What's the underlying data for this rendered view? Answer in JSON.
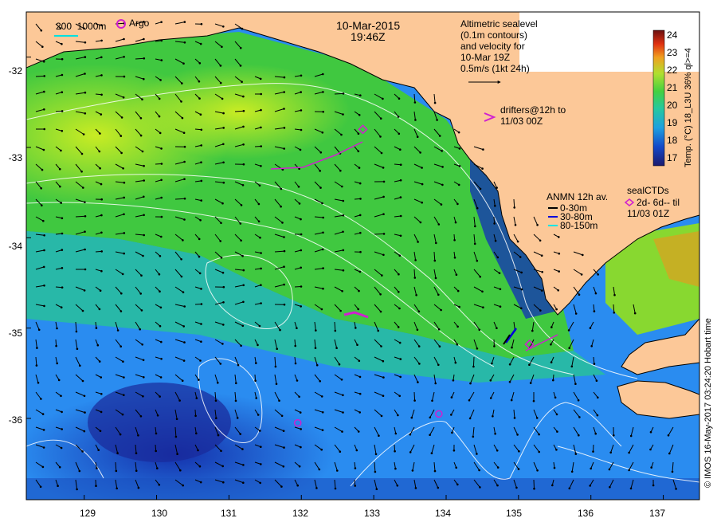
{
  "header": {
    "date": "10-Mar-2015",
    "time": "19:46Z"
  },
  "legend": {
    "isobath": "200  1000m",
    "argo": "Argo",
    "altimetry_lines": [
      "Altimetric sealevel",
      "(0.1m contours)",
      "and velocity for",
      "10-Mar 19Z",
      "0.5m/s (1kt 24h)"
    ],
    "drifters_lines": [
      "drifters@12h to",
      "11/03 00Z"
    ],
    "anmn_title": "ANMN 12h av.",
    "anmn_items": [
      {
        "label": "0-30m",
        "color": "#000000"
      },
      {
        "label": "30-80m",
        "color": "#0000dd"
      },
      {
        "label": "80-150m",
        "color": "#00e5e5"
      }
    ],
    "seal_title": "sealCTDs",
    "seal_lines": [
      "2d- 6d-- til",
      "11/03 01Z"
    ]
  },
  "colorbar": {
    "title": "Temp. (°C) 18_L3U 36% ql>=4",
    "ticks": [
      "17",
      "18",
      "19",
      "20",
      "21",
      "22",
      "23",
      "24"
    ],
    "colors": [
      "#1c1a6e",
      "#1448c8",
      "#1ea0e0",
      "#24c8a0",
      "#44d040",
      "#b0e030",
      "#f0a020",
      "#e03010",
      "#6a1010"
    ]
  },
  "axes": {
    "x_ticks": [
      "129",
      "130",
      "131",
      "132",
      "133",
      "134",
      "135",
      "136",
      "137"
    ],
    "y_ticks": [
      "-32",
      "-33",
      "-34",
      "-35",
      "-36"
    ],
    "xlim": [
      128.2,
      137.5
    ],
    "ylim": [
      -36.9,
      -31.5
    ]
  },
  "markers": {
    "argo": [
      [
        131.95,
        -36.05
      ],
      [
        133.9,
        -35.95
      ]
    ],
    "seal": [
      [
        132.85,
        -32.8
      ],
      [
        135.15,
        -35.18
      ]
    ]
  },
  "credit": "© IMOS 16-May-2017 03:24:20 Hobart time"
}
